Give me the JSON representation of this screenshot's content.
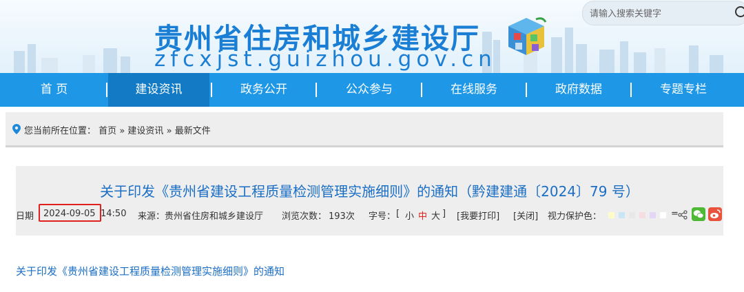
{
  "header": {
    "site_title": "贵州省住房和城乡建设厅",
    "site_domain": "zfcxjst.guizhou.gov.cn",
    "search_placeholder": "请输入搜索关键字",
    "title_color": "#1a7fd4"
  },
  "nav": {
    "items": [
      {
        "label": "首  页"
      },
      {
        "label": "建设资讯",
        "active": true
      },
      {
        "label": "政务公开"
      },
      {
        "label": "公众参与"
      },
      {
        "label": "在线服务"
      },
      {
        "label": "政府数据"
      },
      {
        "label": "专题专栏"
      }
    ],
    "background": "#1e98e6",
    "active_background": "#137bc6"
  },
  "breadcrumb": {
    "prefix": "您当前所在位置：",
    "items": [
      "首页",
      "»",
      "建设资讯",
      "»",
      "最新文件"
    ]
  },
  "article": {
    "title": "关于印发《贵州省建设工程质量检测管理实施细则》的通知（黔建建通〔2024〕79 号）",
    "date_label": "日期",
    "date": "2024-09-05",
    "time": "14:50",
    "source_label": "来源：",
    "source": "贵州省住房和城乡建设厅",
    "views_label": "浏览次数：",
    "views": "193次",
    "font_size_label": "字号：",
    "bracket_open": "[",
    "bracket_close": "]",
    "font_small": "小",
    "font_medium": "中",
    "font_large": "大",
    "print_label": "[我要打印]",
    "close_label": "[关闭]",
    "eye_care_label": "视力保护色：",
    "eye_care_colors": [
      "#fdfbc8",
      "#c9e6f6",
      "#e8e8e8",
      "#f8dce4",
      "#e4d6f4",
      "#ffffff"
    ],
    "share_separator": "=",
    "highlight_color": "#e0201c",
    "title_color": "#1a6ec4"
  },
  "document_link": "关于印发《贵州省建设工程质量检测管理实施细则》的通知"
}
